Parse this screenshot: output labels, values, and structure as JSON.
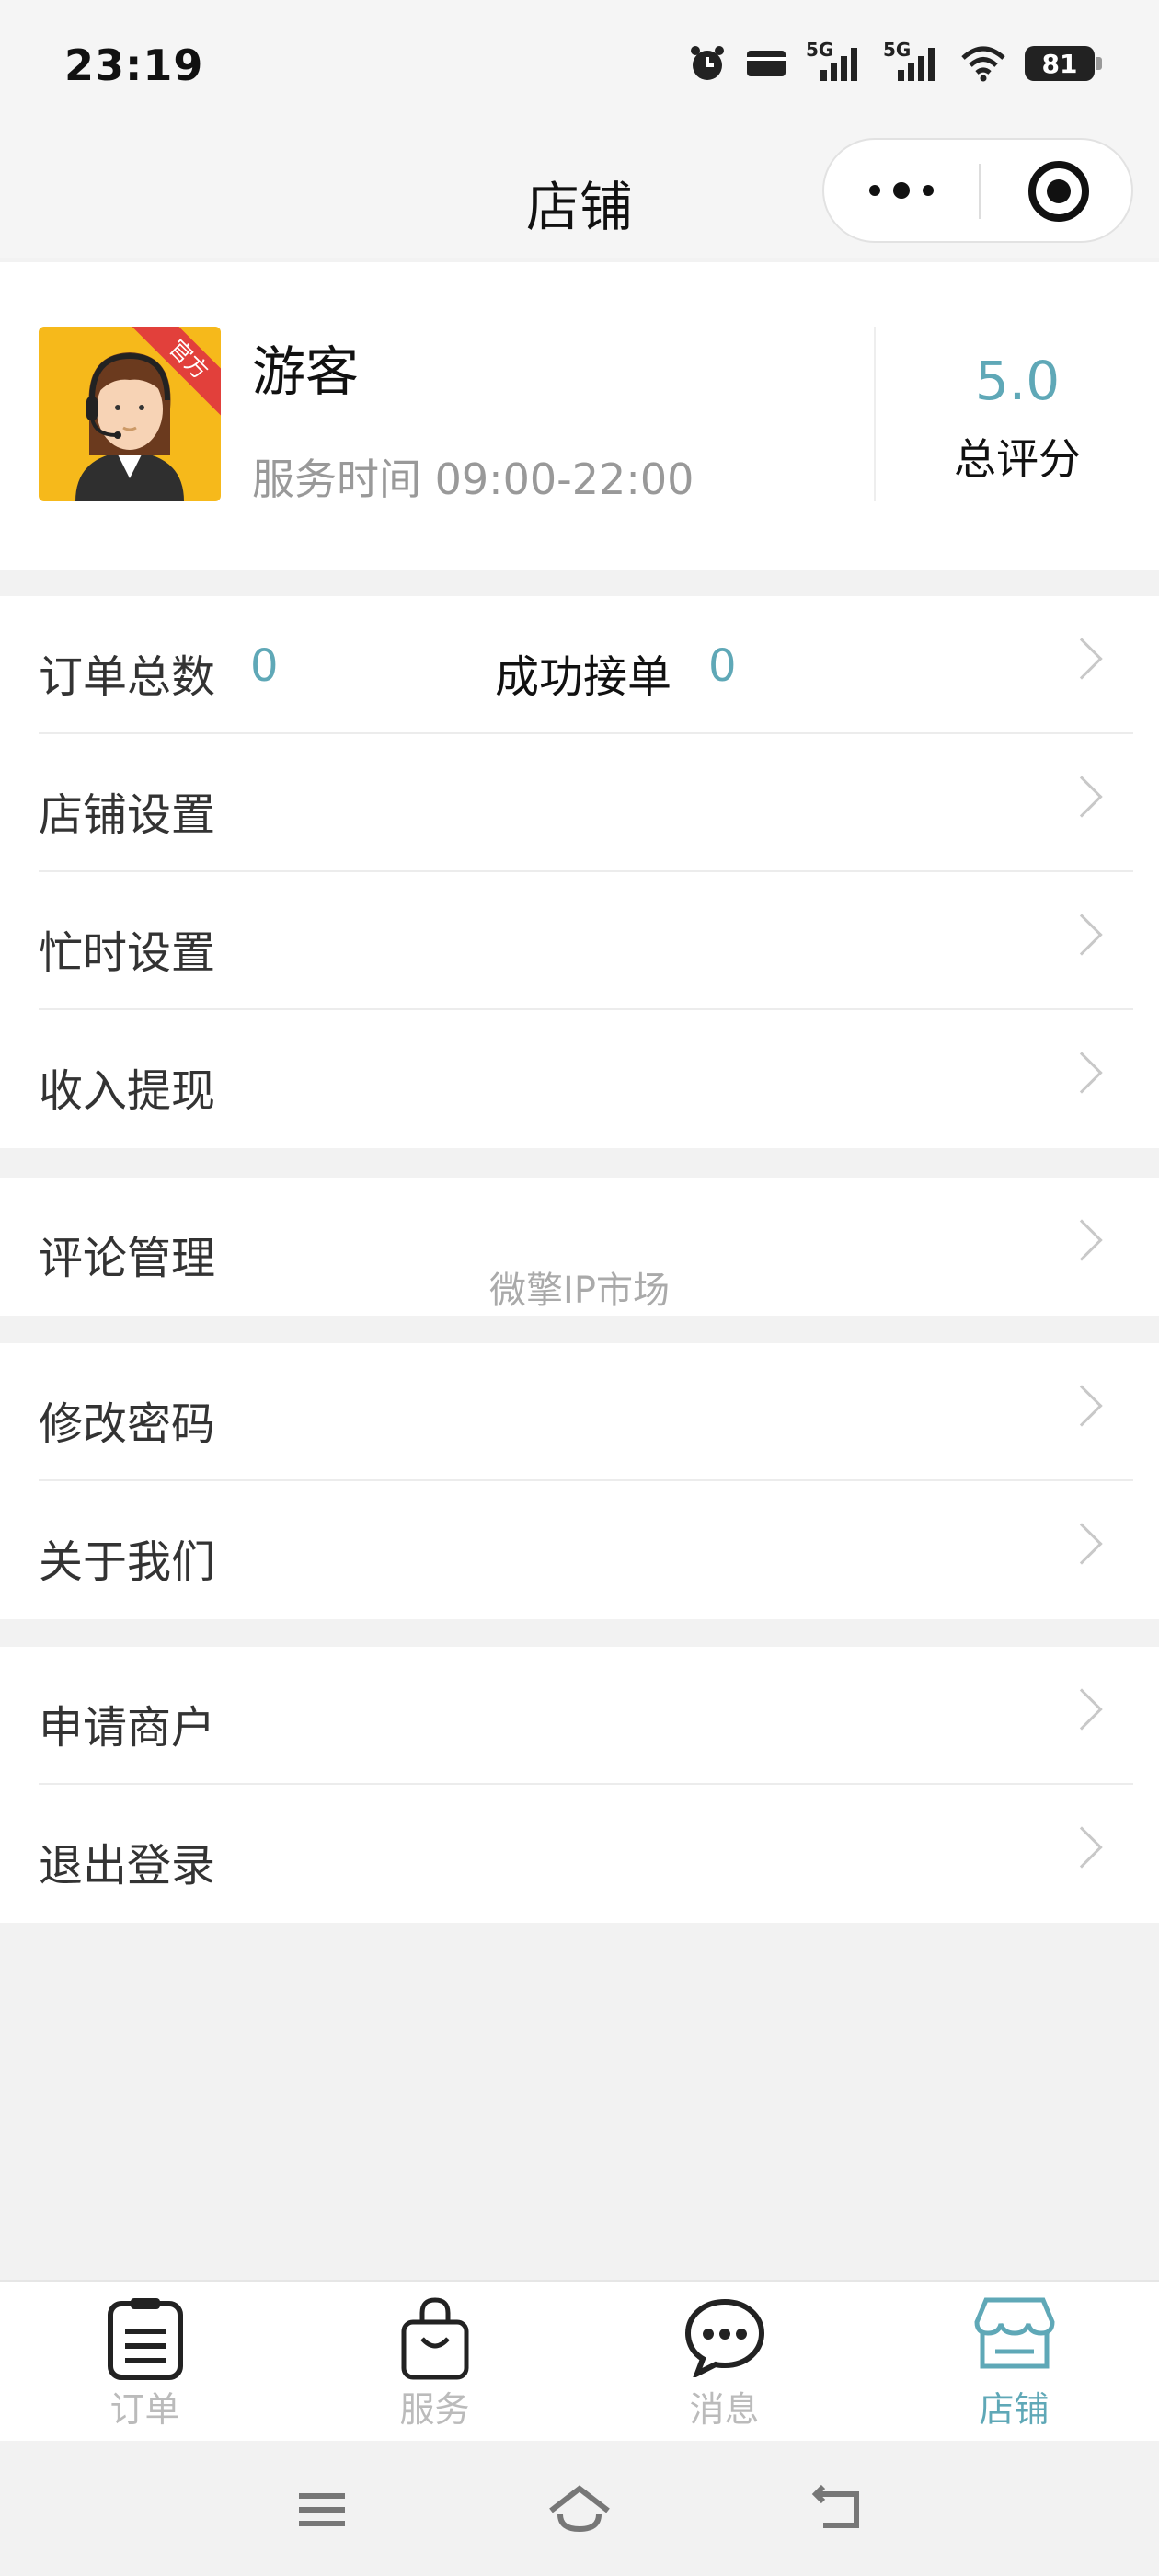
{
  "status_bar": {
    "time": "23:19",
    "battery": "81",
    "signal_label_1": "5G",
    "signal_label_2": "5G",
    "icons": [
      "alarm-icon",
      "card-icon",
      "signal-5g-icon",
      "signal-5g-icon",
      "wifi-icon",
      "battery-icon"
    ]
  },
  "navbar": {
    "title": "店铺",
    "menu_icon": "more-dots-icon",
    "close_icon": "target-icon"
  },
  "profile": {
    "name": "游客",
    "badge": "官方",
    "service_time": "服务时间 09:00-22:00",
    "rating": "5.0",
    "rating_label": "总评分"
  },
  "menu": {
    "order_total_label": "订单总数",
    "order_total_value": "0",
    "success_label": "成功接单",
    "success_value": "0",
    "shop_settings": "店铺设置",
    "busy_settings": "忙时设置",
    "withdraw": "收入提现",
    "comments": "评论管理",
    "change_password": "修改密码",
    "about_us": "关于我们",
    "apply_merchant": "申请商户",
    "logout": "退出登录"
  },
  "watermark": "微擎IP市场",
  "tabbar": {
    "items": [
      {
        "label": "订单",
        "icon": "clipboard-icon",
        "active": false
      },
      {
        "label": "服务",
        "icon": "shopping-bag-icon",
        "active": false
      },
      {
        "label": "消息",
        "icon": "chat-bubble-icon",
        "active": false
      },
      {
        "label": "店铺",
        "icon": "store-icon",
        "active": true
      }
    ]
  },
  "colors": {
    "accent": "#5fa8b7",
    "background": "#f2f2f2",
    "ribbon": "#e2403b",
    "avatar_bg": "#f6b91b"
  }
}
